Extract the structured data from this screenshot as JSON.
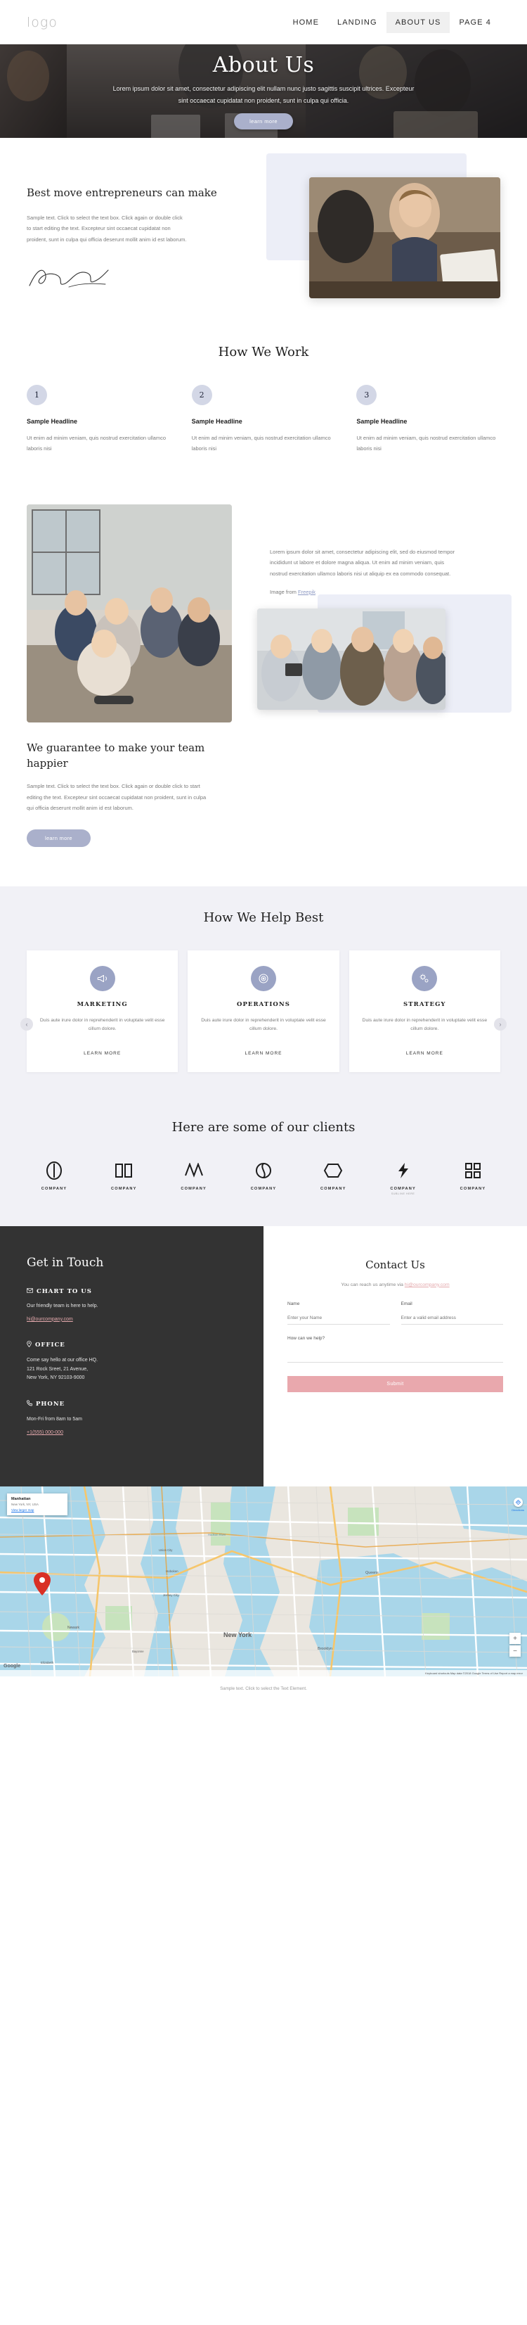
{
  "header": {
    "logo": "logo",
    "nav": [
      {
        "label": "HOME",
        "active": false
      },
      {
        "label": "LANDING",
        "active": false
      },
      {
        "label": "ABOUT US",
        "active": true
      },
      {
        "label": "PAGE 4",
        "active": false
      }
    ]
  },
  "hero": {
    "title": "About Us",
    "paragraph": "Lorem ipsum dolor sit amet, consectetur adipiscing elit nullam nunc justo sagittis suscipit ultrices. Excepteur sint occaecat cupidatat non proident, sunt in culpa qui officia.",
    "button": "learn more"
  },
  "best": {
    "heading": "Best move entrepreneurs can make",
    "paragraph": "Sample text. Click to select the text box. Click again or double click to start editing the text. Excepteur sint occaecat cupidatat non proident, sunt in culpa qui officia deserunt mollit anim id est laborum.",
    "signature_alt": "handwritten-signature"
  },
  "how_we_work": {
    "title": "How We Work",
    "steps": [
      {
        "number": "1",
        "heading": "Sample Headline",
        "text": "Ut enim ad minim veniam, quis nostrud exercitation ullamco laboris nisi"
      },
      {
        "number": "2",
        "heading": "Sample Headline",
        "text": "Ut enim ad minim veniam, quis nostrud exercitation ullamco laboris nisi"
      },
      {
        "number": "3",
        "heading": "Sample Headline",
        "text": "Ut enim ad minim veniam, quis nostrud exercitation ullamco laboris nisi"
      }
    ]
  },
  "guarantee": {
    "heading": "We guarantee to make your team happier",
    "paragraph": "Sample text. Click to select the text box. Click again or double click to start editing the text. Excepteur sint occaecat cupidatat non proident, sunt in culpa qui officia deserunt mollit anim id est laborum.",
    "button": "learn more",
    "side_text": "Lorem ipsum dolor sit amet, consectetur adipiscing elit, sed do eiusmod tempor incididunt ut labore et dolore magna aliqua. Ut enim ad minim veniam, quis nostrud exercitation ullamco laboris nisi ut aliquip ex ea commodo consequat.",
    "credit_prefix": "Image from ",
    "credit_link": "Freepik"
  },
  "help": {
    "title": "How We Help Best",
    "cards": [
      {
        "icon": "megaphone-icon",
        "title": "MARKETING",
        "text": "Duis aute irure dolor in reprehenderit in voluptate velit esse cillum dolore.",
        "link": "LEARN MORE"
      },
      {
        "icon": "target-icon",
        "title": "OPERATIONS",
        "text": "Duis aute irure dolor in reprehenderit in voluptate velit esse cillum dolore.",
        "link": "LEARN MORE"
      },
      {
        "icon": "gears-icon",
        "title": "STRATEGY",
        "text": "Duis aute irure dolor in reprehenderit in voluptate velit esse cillum dolore.",
        "link": "LEARN MORE"
      }
    ],
    "prev": "‹",
    "next": "›"
  },
  "clients": {
    "title": "Here are some of our clients",
    "logos": [
      {
        "name": "COMPANY",
        "sub": ""
      },
      {
        "name": "COMPANY",
        "sub": ""
      },
      {
        "name": "COMPANY",
        "sub": ""
      },
      {
        "name": "COMPANY",
        "sub": ""
      },
      {
        "name": "COMPANY",
        "sub": ""
      },
      {
        "name": "COMPANY",
        "sub": "SUBLINE HERE"
      },
      {
        "name": "COMPANY",
        "sub": ""
      }
    ]
  },
  "contact": {
    "left_title": "Get in Touch",
    "blocks": [
      {
        "icon": "envelope-icon",
        "head": "CHART TO US",
        "lines": [
          "Our friendly team is here to help."
        ],
        "link": "hi@ourcompany.com"
      },
      {
        "icon": "pin-icon",
        "head": "OFFICE",
        "lines": [
          "Come say hello at our office HQ.",
          "121 Rock Sreet, 21 Avenue,",
          "New York, NY 92103-9000"
        ],
        "link": ""
      },
      {
        "icon": "phone-icon",
        "head": "PHONE",
        "lines": [
          "Mon-Fri from 8am to 5am"
        ],
        "link": "+1(555) 000-000"
      }
    ],
    "form_title": "Contact Us",
    "form_sub_prefix": "You can reach us anytime via ",
    "form_sub_link": "hi@ourcompany.com",
    "fields": [
      {
        "label": "Name",
        "placeholder": "Enter your Name",
        "value": ""
      },
      {
        "label": "Email",
        "placeholder": "Enter a valid email address",
        "value": ""
      }
    ],
    "message_label": "How can we help?",
    "message_placeholder": "",
    "submit": "Submit"
  },
  "map": {
    "place_title": "Manhattan",
    "place_sub": "New York, NY, USA",
    "view_link": "View larger map",
    "directions": "Directions",
    "zoom_in": "+",
    "zoom_out": "−",
    "brand": "Google",
    "labels": [
      "New York",
      "Newark",
      "Jersey City",
      "Hoboken",
      "Brooklyn",
      "Queens",
      "Elizabeth",
      "Bayonne",
      "Hudson River",
      "Union City"
    ],
    "attribution": "Keyboard shortcuts   Map data ©2018 Google   Terms of Use   Report a map error"
  },
  "footer": {
    "text": "Sample text. Click to select the Text Element."
  },
  "colors": {
    "accent_lavender": "#aab0cb",
    "panel_lavender": "#eceef7",
    "dark": "#333333",
    "pink": "#e9a8ad",
    "page_bg_grey": "#f1f1f6"
  }
}
